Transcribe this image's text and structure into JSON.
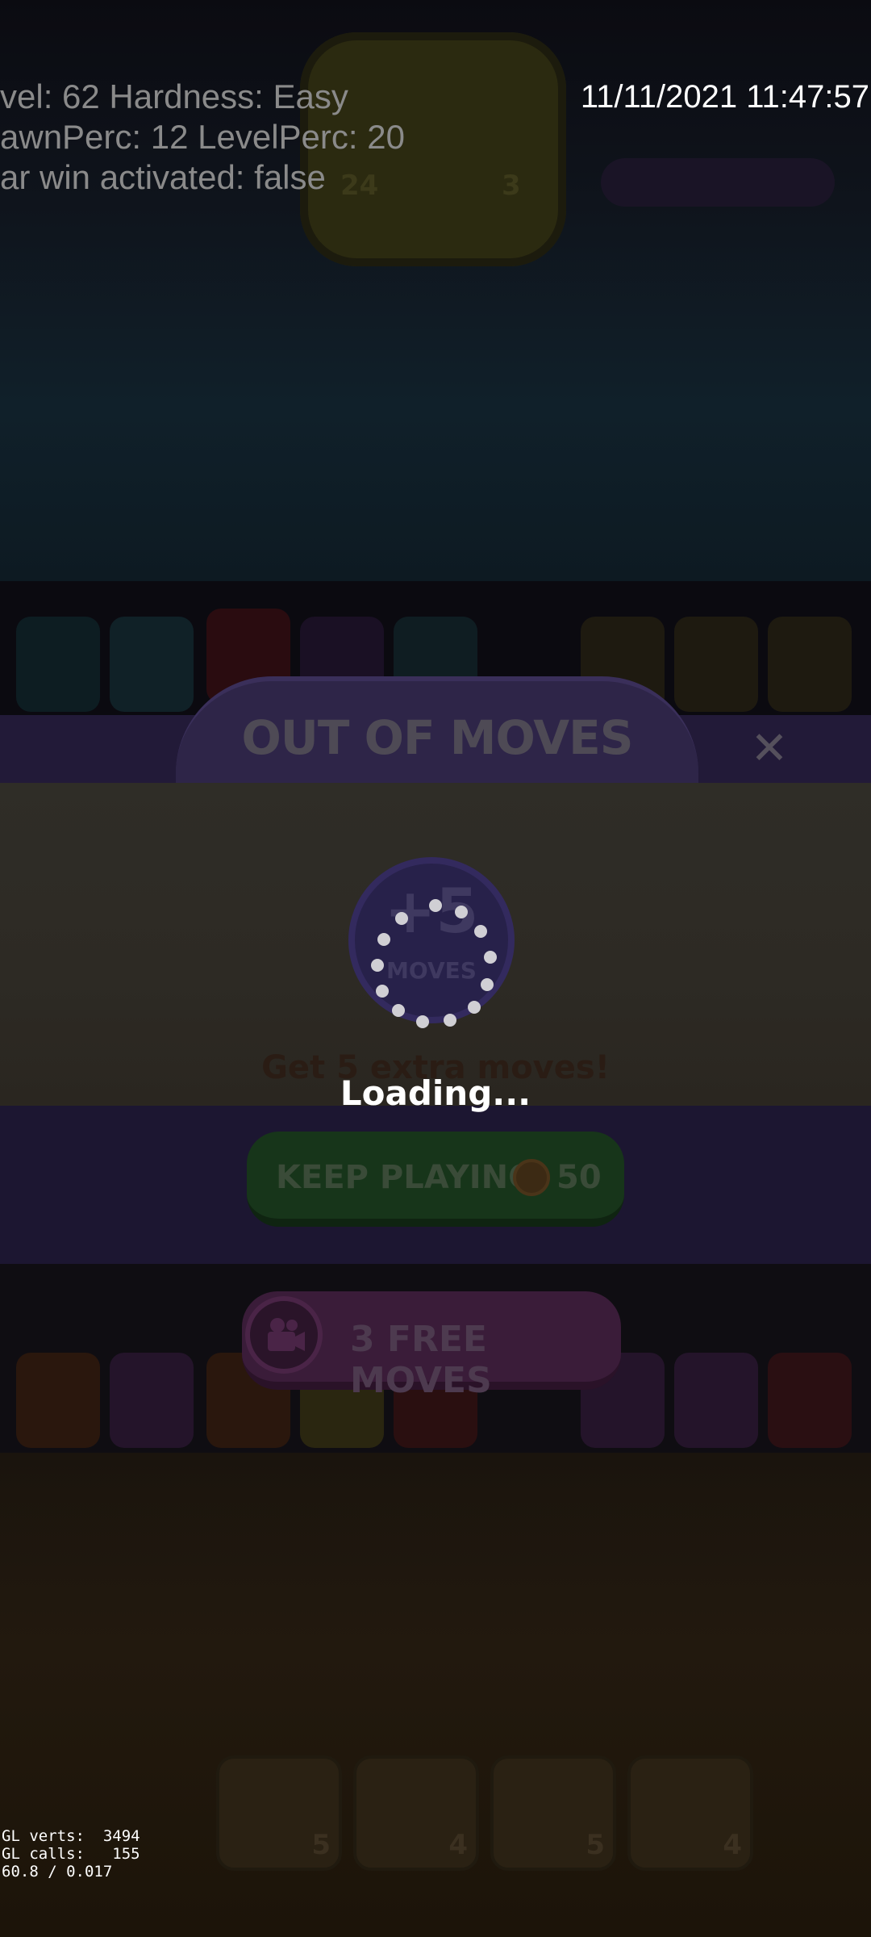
{
  "debug": {
    "line1": "vel: 62 Hardness: Easy",
    "line2": "awnPerc: 12 LevelPerc: 20",
    "line3": "ar win activated: false",
    "timestamp": "11/11/2021 11:47:57",
    "gl_verts": "GL verts:  3494",
    "gl_calls": "GL calls:   155",
    "fps": "60.8 / 0.017"
  },
  "background": {
    "card_left_number": "24",
    "card_right_number": "3",
    "slot_counts": [
      "5",
      "4",
      "5",
      "4"
    ]
  },
  "modal": {
    "title": "OUT OF MOVES",
    "close_symbol": "✕",
    "badge_plus": "+5",
    "badge_moves": "MOVES",
    "subtitle": "Get 5 extra moves!",
    "loading": "Loading...",
    "keep_playing_label": "KEEP PLAYING",
    "keep_playing_cost": "50",
    "free_moves_label": "3 FREE MOVES"
  },
  "colors": {
    "title_band": "#221a38",
    "panel": "#2d2a24",
    "keep_button": "#17351a",
    "free_button": "#3a1c39",
    "loading_text": "#ffffff"
  },
  "icons": [
    "close-icon",
    "coin-icon",
    "camera-icon",
    "loading-spinner-icon"
  ]
}
